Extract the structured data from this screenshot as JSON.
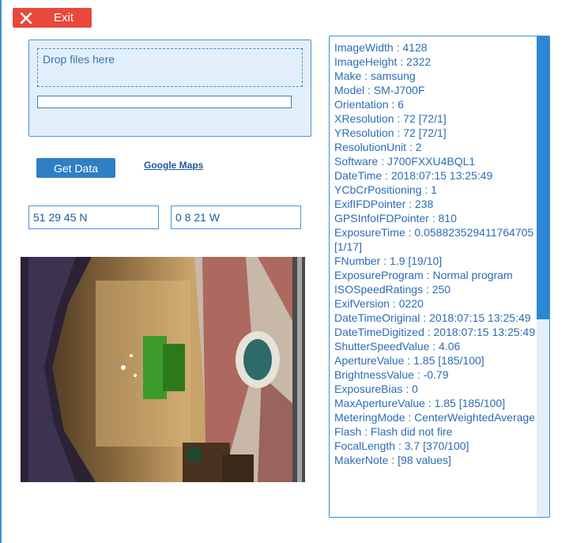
{
  "colors": {
    "accent": "#2f7fc6",
    "exit_button": "#e8493a",
    "panel_bg": "#e2effa",
    "text": "#2a6db5"
  },
  "toolbar": {
    "exit_label": "Exit",
    "exit_icon": "close-icon"
  },
  "upload": {
    "drop_label": "Drop files here",
    "progress_fraction": 0
  },
  "actions": {
    "get_data_label": "Get Data",
    "google_maps_label": "Google Maps"
  },
  "coordinates": {
    "latitude": "51 29 45 N",
    "longitude": "0 8 21 W"
  },
  "photo": {
    "subject": "church interior photo (rotated)"
  },
  "exif": {
    "lines": [
      "ImageWidth : 4128",
      "ImageHeight : 2322",
      "Make : samsung",
      "Model : SM-J700F",
      "Orientation : 6",
      "XResolution : 72 [72/1]",
      "YResolution : 72 [72/1]",
      "ResolutionUnit : 2",
      "Software : J700FXXU4BQL1",
      "DateTime : 2018:07:15 13:25:49",
      "YCbCrPositioning : 1",
      "ExifIFDPointer : 238",
      "GPSInfoIFDPointer : 810",
      "ExposureTime : 0.058823529411764705 [1/17]",
      "FNumber : 1.9 [19/10]",
      "ExposureProgram : Normal program",
      "ISOSpeedRatings : 250",
      "ExifVersion : 0220",
      "DateTimeOriginal : 2018:07:15 13:25:49",
      "DateTimeDigitized : 2018:07:15 13:25:49",
      "ShutterSpeedValue : 4.06",
      "ApertureValue : 1.85 [185/100]",
      "BrightnessValue : -0.79",
      "ExposureBias : 0",
      "MaxApertureValue : 1.85 [185/100]",
      "MeteringMode : CenterWeightedAverage",
      "Flash : Flash did not fire",
      "FocalLength : 3.7 [370/100]",
      "MakerNote : [98 values]"
    ]
  }
}
